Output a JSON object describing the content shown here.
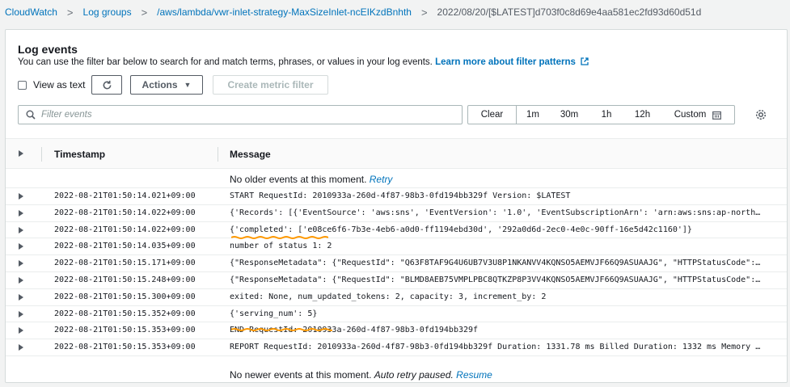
{
  "breadcrumb": {
    "items": [
      "CloudWatch",
      "Log groups",
      "/aws/lambda/vwr-inlet-strategy-MaxSizeInlet-ncEIKzdBnhth"
    ],
    "separator": ">",
    "current": "2022/08/20/[$LATEST]d703f0c8d69e4aa581ec2fd93d60d51d"
  },
  "header": {
    "title": "Log events",
    "description": "You can use the filter bar below to search for and match terms, phrases, or values in your log events.",
    "learn_more": "Learn more about filter patterns"
  },
  "toolbar": {
    "view_as_text": "View as text",
    "view_as_text_checked": false,
    "actions_label": "Actions",
    "create_metric_filter": "Create metric filter"
  },
  "filter": {
    "placeholder": "Filter events",
    "value": ""
  },
  "time_range": {
    "clear": "Clear",
    "options": [
      "1m",
      "30m",
      "1h",
      "12h"
    ],
    "custom": "Custom"
  },
  "table": {
    "headers": {
      "timestamp": "Timestamp",
      "message": "Message"
    },
    "top_notice": "No older events at this moment.",
    "top_notice_link": "Retry",
    "bottom_notice": "No newer events at this moment.",
    "bottom_notice_italic": "Auto retry paused.",
    "bottom_notice_link": "Resume",
    "rows": [
      {
        "timestamp": "2022-08-21T01:50:14.021+09:00",
        "message": "START RequestId: 2010933a-260d-4f87-98b3-0fd194bb329f Version: $LATEST"
      },
      {
        "timestamp": "2022-08-21T01:50:14.022+09:00",
        "message": "{'Records': [{'EventSource': 'aws:sns', 'EventVersion': '1.0', 'EventSubscriptionArn': 'arn:aws:sns:ap-northea..."
      },
      {
        "timestamp": "2022-08-21T01:50:14.022+09:00",
        "message": "{'completed': ['e08ce6f6-7b3e-4eb6-a0d0-ff1194ebd30d', '292a0d6d-2ec0-4e0c-90ff-16e5d42c1160']}"
      },
      {
        "timestamp": "2022-08-21T01:50:14.035+09:00",
        "message": "number of status 1: 2"
      },
      {
        "timestamp": "2022-08-21T01:50:15.171+09:00",
        "message": "{\"ResponseMetadata\": {\"RequestId\": \"Q63F8TAF9G4U6UB7V3U8P1NKANVV4KQNSO5AEMVJF66Q9ASUAAJG\", \"HTTPStatusCode\": 2..."
      },
      {
        "timestamp": "2022-08-21T01:50:15.248+09:00",
        "message": "{\"ResponseMetadata\": {\"RequestId\": \"BLMD8AEB75VMPLPBC8QTKZP8P3VV4KQNSO5AEMVJF66Q9ASUAAJG\", \"HTTPStatusCode\": 2..."
      },
      {
        "timestamp": "2022-08-21T01:50:15.300+09:00",
        "message": "exited: None, num_updated_tokens: 2, capacity: 3, increment_by: 2"
      },
      {
        "timestamp": "2022-08-21T01:50:15.352+09:00",
        "message": "{'serving_num': 5}"
      },
      {
        "timestamp": "2022-08-21T01:50:15.353+09:00",
        "message": "END RequestId: 2010933a-260d-4f87-98b3-0fd194bb329f"
      },
      {
        "timestamp": "2022-08-21T01:50:15.353+09:00",
        "message": "REPORT RequestId: 2010933a-260d-4f87-98b3-0fd194bb329f Duration: 1331.78 ms Billed Duration: 1332 ms Memory Si..."
      }
    ]
  },
  "colors": {
    "link": "#0073bb",
    "annotation": "#ff9900"
  }
}
